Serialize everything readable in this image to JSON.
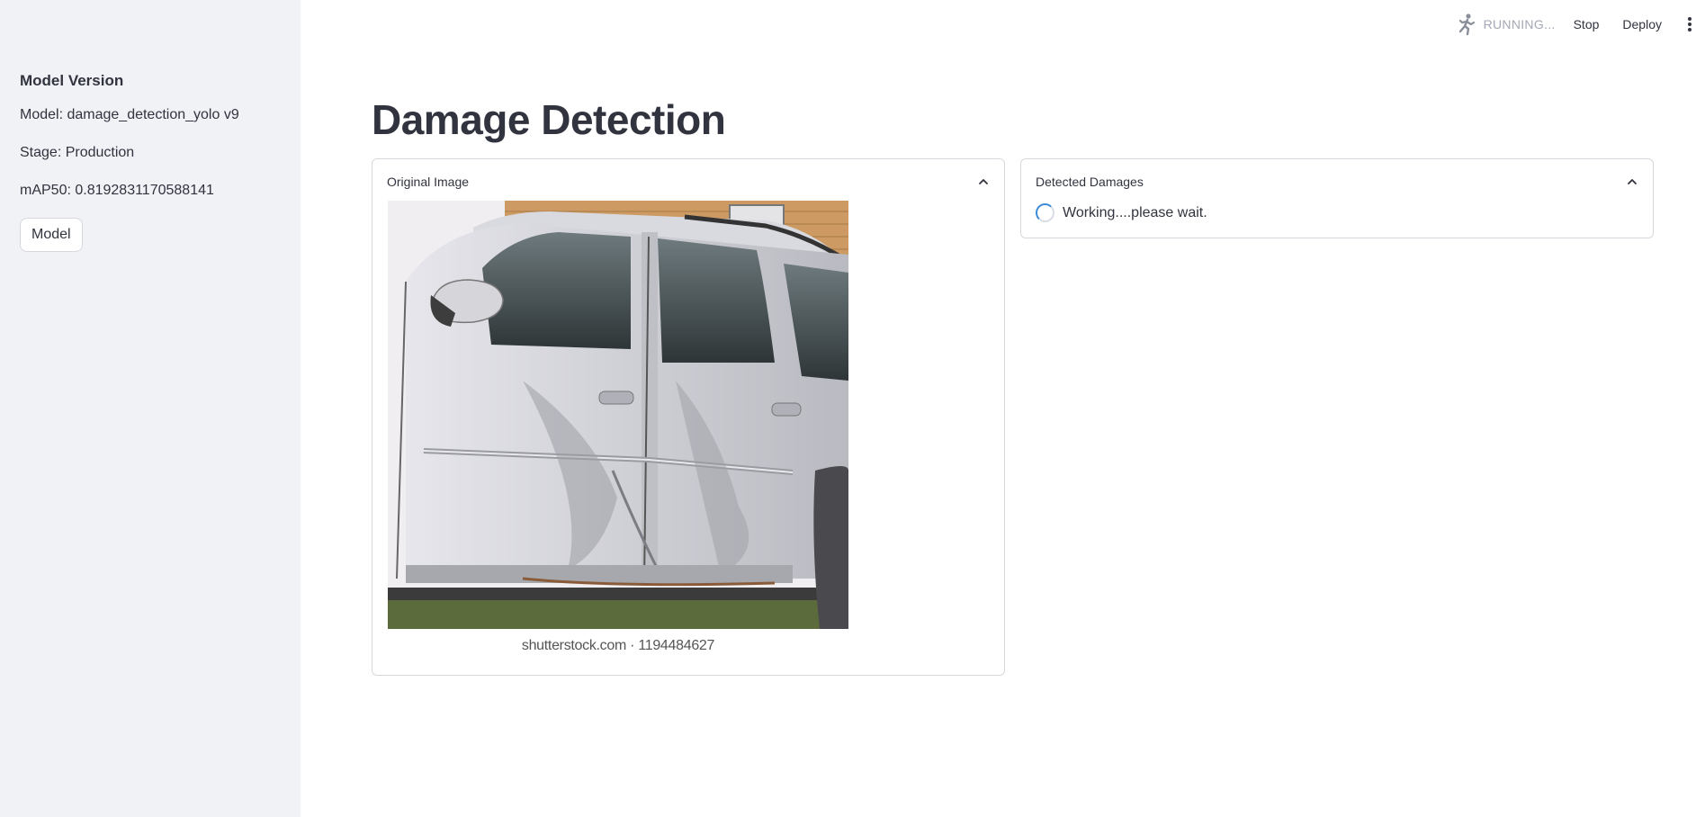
{
  "sidebar": {
    "heading": "Model Version",
    "model_line": "Model: damage_detection_yolo v9",
    "stage_line": "Stage: Production",
    "map_line": "mAP50: 0.8192831170588141",
    "model_button": "Model"
  },
  "toolbar": {
    "status": "RUNNING...",
    "stop_label": "Stop",
    "deploy_label": "Deploy",
    "status_icon": "running-man-icon",
    "menu_icon": "kebab-menu-icon"
  },
  "main": {
    "title": "Damage Detection",
    "original": {
      "label": "Original Image",
      "caption": "shutterstock.com · 1194484627"
    },
    "detected": {
      "label": "Detected Damages",
      "status": "Working....please wait."
    }
  },
  "colors": {
    "sidebar_bg": "#f0f2f6",
    "text": "#31333f",
    "spinner": "#3b8ad9"
  }
}
